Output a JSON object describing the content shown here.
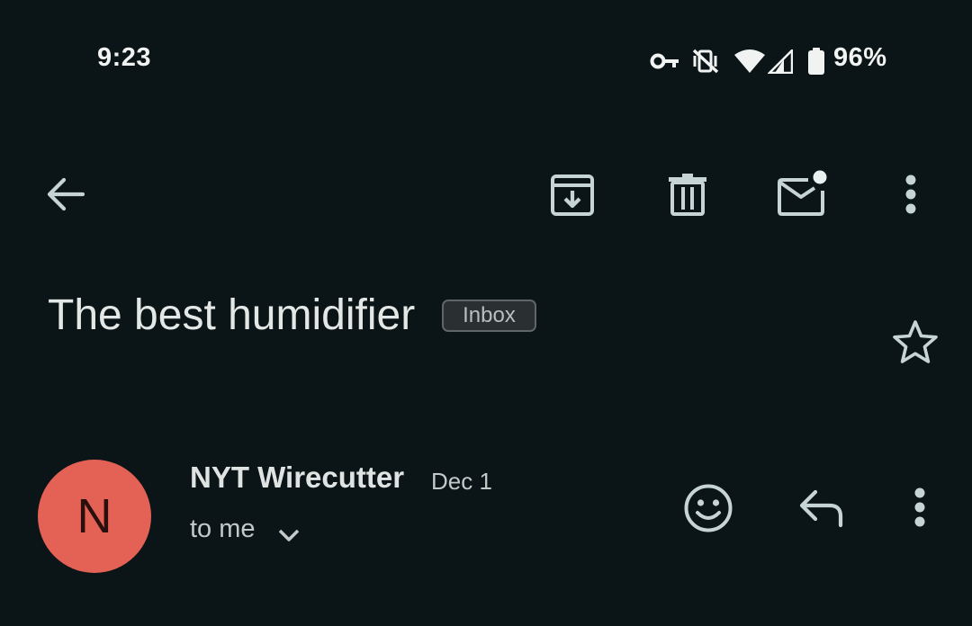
{
  "status_bar": {
    "time": "9:23",
    "battery_percent": "96%",
    "icons": [
      "vpn-key-icon",
      "vibrate-off-icon",
      "wifi-icon",
      "cell-signal-icon",
      "battery-icon"
    ]
  },
  "toolbar": {
    "icons": [
      "back-arrow-icon",
      "archive-icon",
      "delete-icon",
      "mark-unread-icon",
      "more-vert-icon"
    ]
  },
  "email": {
    "subject": "The best humidifier",
    "label": "Inbox",
    "starred": false,
    "sender": "NYT Wirecutter",
    "avatar_letter": "N",
    "avatar_color": "#e46255",
    "date": "Dec 1",
    "recipient": "to me"
  },
  "message_actions": {
    "icons": [
      "emoji-reaction-icon",
      "reply-icon",
      "more-vert-icon"
    ]
  },
  "colors": {
    "background": "#0b1416",
    "text": "#e2e6e5",
    "icon": "#c6d4d4"
  }
}
